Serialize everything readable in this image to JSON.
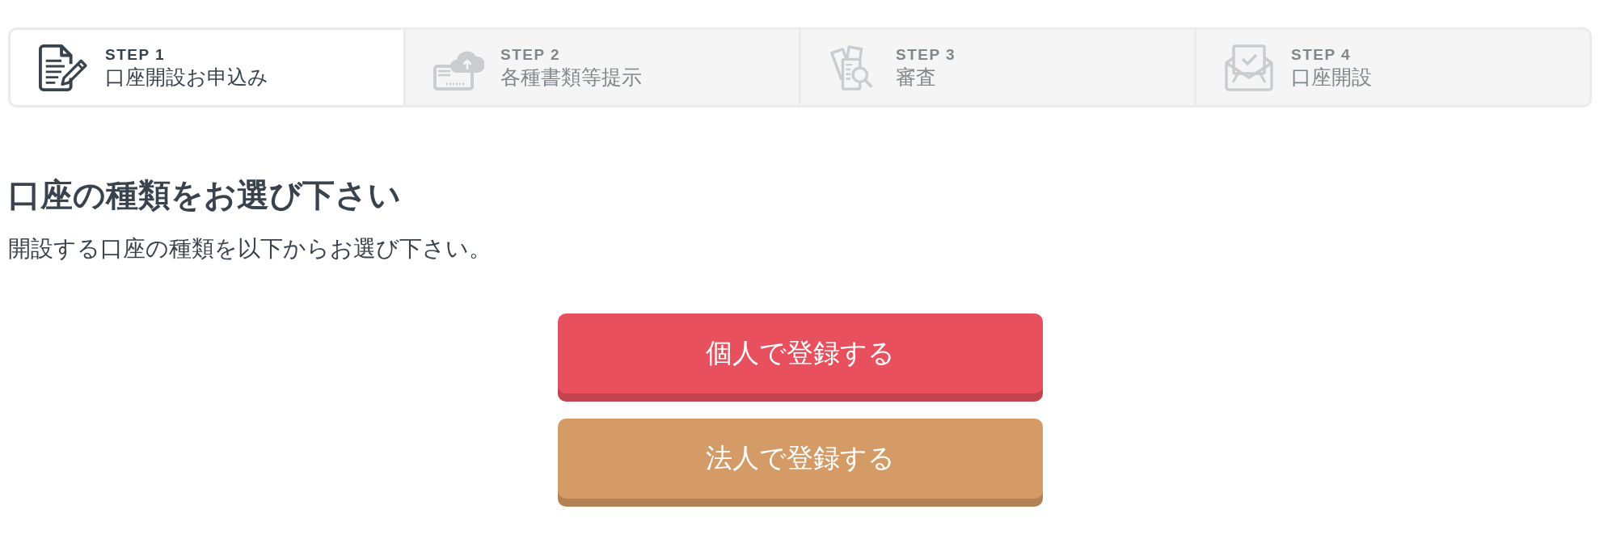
{
  "steps": [
    {
      "number": "STEP 1",
      "label": "口座開設お申込み",
      "selected": true
    },
    {
      "number": "STEP 2",
      "label": "各種書類等提示",
      "selected": false
    },
    {
      "number": "STEP 3",
      "label": "審査",
      "selected": false
    },
    {
      "number": "STEP 4",
      "label": "口座開設",
      "selected": false
    }
  ],
  "heading": "口座の種類をお選び下さい",
  "description": "開設する口座の種類を以下からお選び下さい。",
  "buttons": [
    {
      "label": "個人で登録する",
      "color": "#e9505d"
    },
    {
      "label": "法人で登録する",
      "color": "#d59b66"
    }
  ]
}
